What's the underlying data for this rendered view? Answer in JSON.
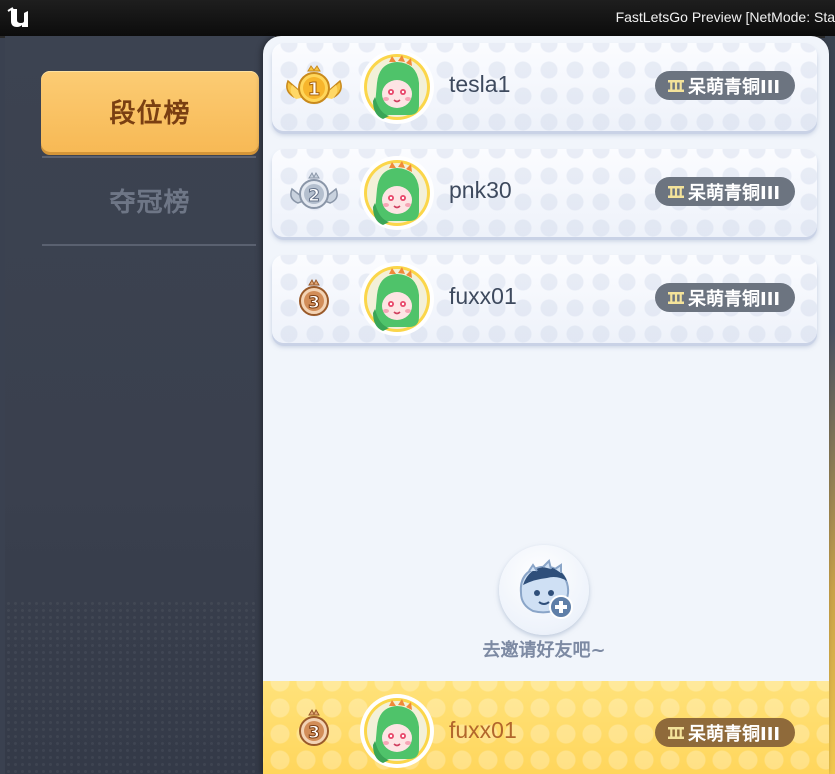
{
  "window": {
    "title": "FastLetsGo Preview [NetMode: Sta"
  },
  "left_tabs": [
    {
      "label": "段位榜",
      "selected": true
    },
    {
      "label": "夺冠榜",
      "selected": false
    }
  ],
  "rank_list": [
    {
      "rank": "1",
      "name": "tesla1",
      "tier": "呆萌青铜III",
      "avatar": "green-dino-avatar"
    },
    {
      "rank": "2",
      "name": "pnk30",
      "tier": "呆萌青铜III",
      "avatar": "green-dino-avatar"
    },
    {
      "rank": "3",
      "name": "fuxx01",
      "tier": "呆萌青铜III",
      "avatar": "green-dino-avatar"
    }
  ],
  "invite": {
    "label": "去邀请好友吧~",
    "icon": "invite-friend-icon"
  },
  "my_rank": {
    "rank": "3",
    "name": "fuxx01",
    "tier": "呆萌青铜III",
    "avatar": "green-dino-avatar"
  },
  "colors": {
    "selected_tab": "#f7b955",
    "gold": "#f2b52e",
    "silver": "#aab4c4",
    "bronze": "#c98a52",
    "tier_pill": "#6c7480",
    "my_row": "#ffd65c"
  }
}
